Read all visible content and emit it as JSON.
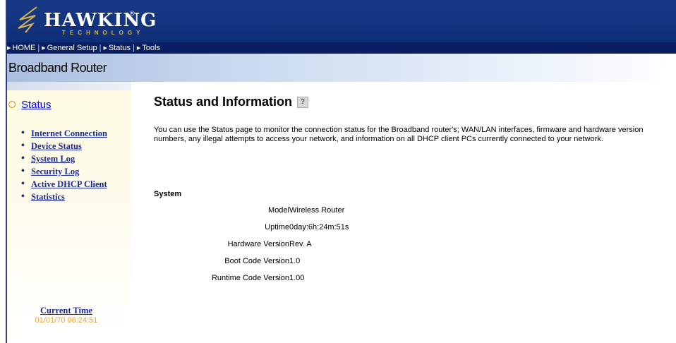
{
  "logo": {
    "text": "HAWKING",
    "sub": "TECHNOLOGY",
    "reg": "®"
  },
  "nav": [
    {
      "label": "HOME"
    },
    {
      "label": "General Setup"
    },
    {
      "label": "Status"
    },
    {
      "label": "Tools"
    }
  ],
  "app_title": "Broadband Router",
  "sidebar": {
    "heading": "Status",
    "items": [
      {
        "label": "Internet Connection"
      },
      {
        "label": "Device Status"
      },
      {
        "label": "System Log"
      },
      {
        "label": "Security Log"
      },
      {
        "label": "Active DHCP Client"
      },
      {
        "label": "Statistics"
      }
    ],
    "current_time_label": "Current Time",
    "current_time_value": "01/01/70 06:24:51"
  },
  "main": {
    "heading": "Status and Information",
    "description": "You can use the Status page to monitor the connection status for the Broadband router's; WAN/LAN interfaces, firmware and hardware version numbers, any illegal attempts to access your network, and information on all DHCP client PCs currently connected to your network.",
    "system": {
      "label": "System",
      "rows": [
        {
          "key": "Model",
          "value": "Wireless Router"
        },
        {
          "key": "Uptime",
          "value": "0day:6h:24m:51s"
        },
        {
          "key": "Hardware Version",
          "value": "Rev. A"
        },
        {
          "key": "Boot Code Version",
          "value": "1.0"
        },
        {
          "key": "Runtime Code Version",
          "value": "1.00"
        }
      ]
    }
  },
  "colors": {
    "header": "#183a86",
    "navbar": "#0a1f63",
    "link": "#1a2a9e",
    "time": "#e8a23a"
  }
}
